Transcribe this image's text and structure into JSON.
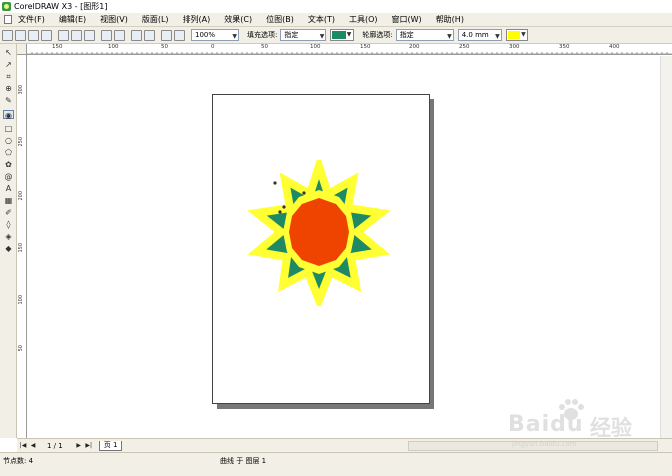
{
  "window": {
    "title": "CorelDRAW X3 - [图形1]"
  },
  "menu": {
    "items": [
      "文件(F)",
      "编辑(E)",
      "视图(V)",
      "版面(L)",
      "排列(A)",
      "效果(C)",
      "位图(B)",
      "文本(T)",
      "工具(O)",
      "窗口(W)",
      "帮助(H)"
    ]
  },
  "toolbar": {
    "zoom": "100%",
    "fill_label": "填充选项:",
    "fill_value": "指定",
    "fill_color": "#1e8a64",
    "outline_label": "轮廓选项:",
    "outline_value": "指定",
    "outline_width": "4.0 mm",
    "outline_color": "#ffff00"
  },
  "ruler": {
    "top_labels": [
      "150",
      "100",
      "50",
      "0",
      "50",
      "100",
      "150",
      "200",
      "250",
      "300",
      "350",
      "400"
    ],
    "left_labels": [
      "300",
      "250",
      "200",
      "150",
      "100",
      "50"
    ]
  },
  "document": {
    "page_nav": "1 / 1",
    "page_tab": "页 1",
    "colors": {
      "star_fill": "#1e8a64",
      "star_outline": "#ffff33",
      "circle_fill": "#ee4400"
    }
  },
  "status": {
    "nodes": "节点数: 4",
    "info": "曲线 于 图层 1"
  },
  "watermark": {
    "brand": "Baidu",
    "product": "经验",
    "url": "jingyan.baidu.com"
  }
}
